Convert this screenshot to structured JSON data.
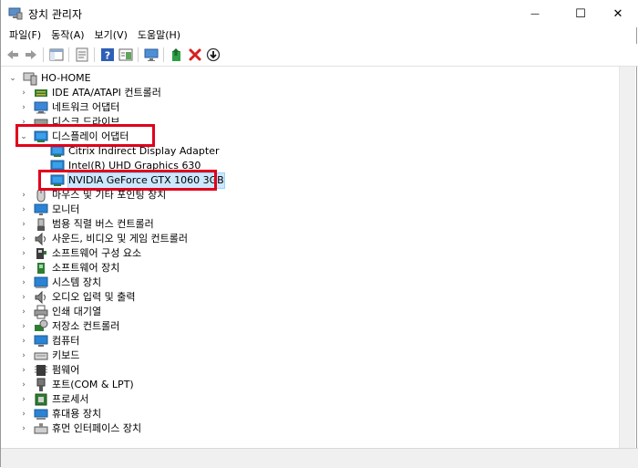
{
  "window": {
    "title": "장치 관리자",
    "minimize_glyph": "—",
    "maximize_glyph": "☐",
    "close_glyph": "✕"
  },
  "menu": [
    {
      "label": "파일(F)"
    },
    {
      "label": "동작(A)"
    },
    {
      "label": "보기(V)"
    },
    {
      "label": "도움말(H)"
    }
  ],
  "toolbar": {
    "back": "back-arrow-icon",
    "forward": "forward-arrow-icon",
    "properties": "properties-icon",
    "update": "update-driver-icon",
    "help": "help-icon",
    "view": "view-icon",
    "scan": "scan-monitor-icon",
    "add": "add-driver-icon",
    "remove": "uninstall-x-icon",
    "download": "download-icon"
  },
  "tree": {
    "root": "HO-HOME",
    "items": [
      {
        "label": "IDE ATA/ATAPI 컨트롤러",
        "icon": "ide-controller-icon",
        "expanded": false
      },
      {
        "label": "네트워크 어댑터",
        "icon": "network-adapter-icon",
        "expanded": false
      },
      {
        "label": "디스크 드라이브",
        "icon": "disk-drive-icon",
        "expanded": false
      },
      {
        "label": "디스플레이 어댑터",
        "icon": "display-adapter-icon",
        "expanded": true,
        "children": [
          {
            "label": "Citrix Indirect Display Adapter"
          },
          {
            "label": "Intel(R) UHD Graphics 630"
          },
          {
            "label": "NVIDIA GeForce GTX 1060 3GB",
            "selected": true
          }
        ]
      },
      {
        "label": "마우스 및 기타 포인팅 장치",
        "icon": "mouse-icon",
        "expanded": false
      },
      {
        "label": "모니터",
        "icon": "monitor-icon",
        "expanded": false
      },
      {
        "label": "범용 직렬 버스 컨트롤러",
        "icon": "usb-icon",
        "expanded": false
      },
      {
        "label": "사운드, 비디오 및 게임 컨트롤러",
        "icon": "sound-icon",
        "expanded": false
      },
      {
        "label": "소프트웨어 구성 요소",
        "icon": "software-component-icon",
        "expanded": false
      },
      {
        "label": "소프트웨어 장치",
        "icon": "software-device-icon",
        "expanded": false
      },
      {
        "label": "시스템 장치",
        "icon": "system-device-icon",
        "expanded": false
      },
      {
        "label": "오디오 입력 및 출력",
        "icon": "audio-io-icon",
        "expanded": false
      },
      {
        "label": "인쇄 대기열",
        "icon": "print-queue-icon",
        "expanded": false
      },
      {
        "label": "저장소 컨트롤러",
        "icon": "storage-controller-icon",
        "expanded": false
      },
      {
        "label": "컴퓨터",
        "icon": "computer-icon",
        "expanded": false
      },
      {
        "label": "키보드",
        "icon": "keyboard-icon",
        "expanded": false
      },
      {
        "label": "펌웨어",
        "icon": "firmware-icon",
        "expanded": false
      },
      {
        "label": "포트(COM & LPT)",
        "icon": "port-icon",
        "expanded": false
      },
      {
        "label": "프로세서",
        "icon": "processor-icon",
        "expanded": false
      },
      {
        "label": "휴대용 장치",
        "icon": "portable-device-icon",
        "expanded": false
      },
      {
        "label": "휴먼 인터페이스 장치",
        "icon": "hid-icon",
        "expanded": false
      }
    ]
  },
  "colors": {
    "highlight_box": "#e0001b",
    "selection": "#cce8ff",
    "monitor_blue": "#2a83d4"
  }
}
